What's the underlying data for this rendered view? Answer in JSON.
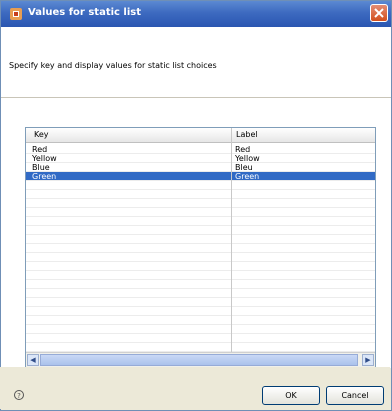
{
  "window": {
    "title": "Values for static list"
  },
  "header": {
    "description": "Specify key and display values for static list choices"
  },
  "toolbar": {
    "add_icon": "plus-icon",
    "delete_icon": "delete-icon"
  },
  "table": {
    "columns": [
      "Key",
      "Label"
    ],
    "rows": [
      {
        "key": "Red",
        "label": "Red"
      },
      {
        "key": "Yellow",
        "label": "Yellow"
      },
      {
        "key": "Blue",
        "label": "Bleu"
      },
      {
        "key": "Green",
        "label": "Green"
      }
    ],
    "selected_index": 3
  },
  "buttons": {
    "ok": "OK",
    "cancel": "Cancel"
  },
  "colors": {
    "selection": "#316ac5",
    "titlebar": "#2a56b1",
    "add": "#2f9b2f",
    "delete": "#cc2020"
  }
}
